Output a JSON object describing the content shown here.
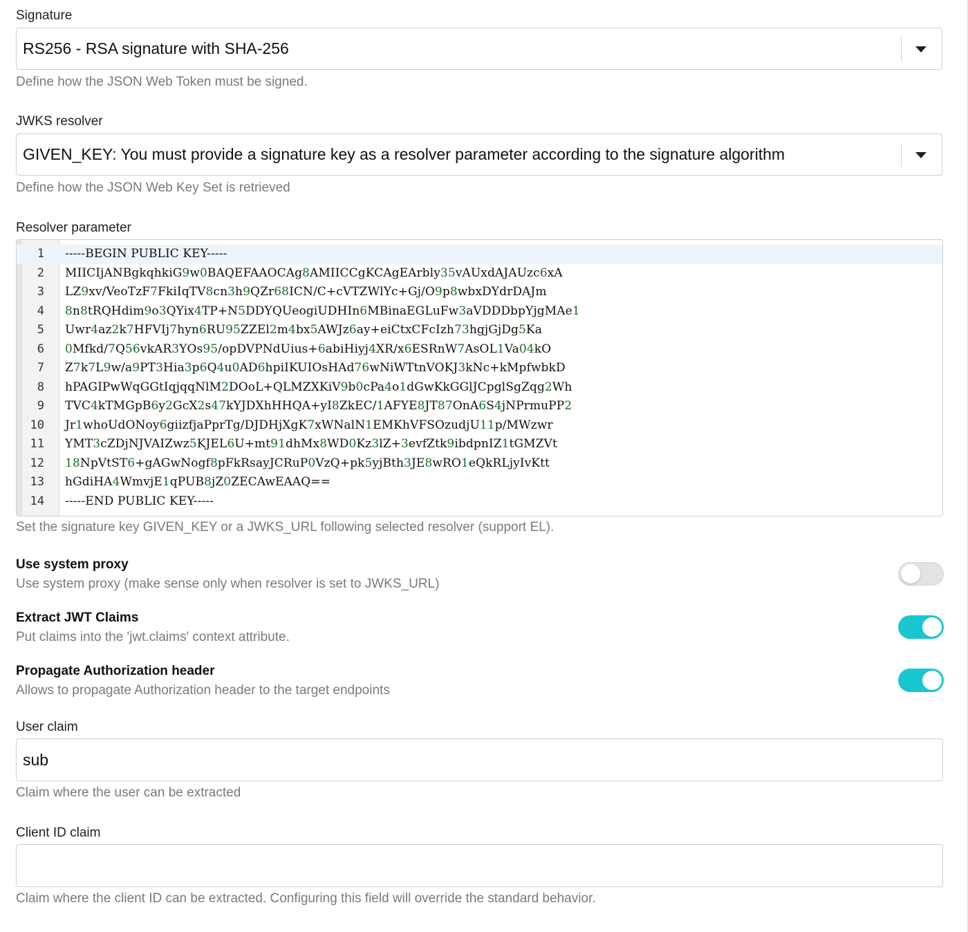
{
  "signature": {
    "label": "Signature",
    "value": "RS256 - RSA signature with SHA-256",
    "hint": "Define how the JSON Web Token must be signed."
  },
  "jwks_resolver": {
    "label": "JWKS resolver",
    "value": "GIVEN_KEY: You must provide a signature key as a resolver parameter according to the signature algorithm",
    "hint": "Define how the JSON Web Key Set is retrieved"
  },
  "resolver_parameter": {
    "label": "Resolver parameter",
    "hint": "Set the signature key GIVEN_KEY or a JWKS_URL following selected resolver (support EL).",
    "lines": [
      "-----BEGIN PUBLIC KEY-----",
      "MIICIjANBgkqhkiG9w0BAQEFAAOCAg8AMIICCgKCAgEArbly35vAUxdAJAUzc6xA",
      "LZ9xv/VeoTzF7FkiIqTV8cn3h9QZr68ICN/C+cVTZWlYc+Gj/O9p8wbxDYdrDAJm",
      "8n8tRQHdim9o3QYix4TP+N5DDYQUeogiUDHIn6MBinaEGLuFw3aVDDDbpYjgMAe1",
      "Uwr4az2k7HFVIj7hyn6RU95ZZEl2m4bx5AWJz6ay+eiCtxCFcIzh73hgjGjDg5Ka",
      "0Mfkd/7Q56vkAR3YOs95/opDVPNdUius+6abiHiyj4XR/x6ESRnW7AsOL1Va04kO",
      "Z7k7L9w/a9PT3Hia3p6Q4u0AD6hpiIKUIOsHAd76wNiWTtnVOKJ3kNc+kMpfwbkD",
      "hPAGIPwWqGGtIqjqqNlM2DOoL+QLMZXKiV9b0cPa4o1dGwKkGGlJCpglSgZqg2Wh",
      "TVC4kTMGpB6y2GcX2s47kYJDXhHHQA+yI8ZkEC/1AFYE8JT87OnA6S4jNPrmuPP2",
      "Jr1whoUdONoy6giizfjaPprTg/DJDHjXgK7xWNalN1EMKhVFSOzudjU11p/MWzwr",
      "YMT3cZDjNJVAIZwz5KJEL6U+mt91dhMx8WD0Kz3lZ+3evfZtk9ibdpnIZ1tGMZVt",
      "18NpVtST6+gAGwNogf8pFkRsayJCRuP0VzQ+pk5yjBth3JE8wRO1eQkRLjyIvKtt",
      "hGdiHA4WmvjE1qPUB8jZ0ZECAwEAAQ==",
      "-----END PUBLIC KEY-----"
    ]
  },
  "use_system_proxy": {
    "title": "Use system proxy",
    "description": "Use system proxy (make sense only when resolver is set to JWKS_URL)",
    "enabled": false
  },
  "extract_jwt_claims": {
    "title": "Extract JWT Claims",
    "description": "Put claims into the 'jwt.claims' context attribute.",
    "enabled": true
  },
  "propagate_auth_header": {
    "title": "Propagate Authorization header",
    "description": "Allows to propagate Authorization header to the target endpoints",
    "enabled": true
  },
  "user_claim": {
    "label": "User claim",
    "value": "sub",
    "hint": "Claim where the user can be extracted"
  },
  "client_id_claim": {
    "label": "Client ID claim",
    "value": "",
    "hint": "Claim where the client ID can be extracted. Configuring this field will override the standard behavior."
  },
  "colors": {
    "toggle_on": "#1ac6cf",
    "toggle_off": "#e3e3e3",
    "digit": "#1a6b2a",
    "hint_text": "#7a7a7a"
  }
}
